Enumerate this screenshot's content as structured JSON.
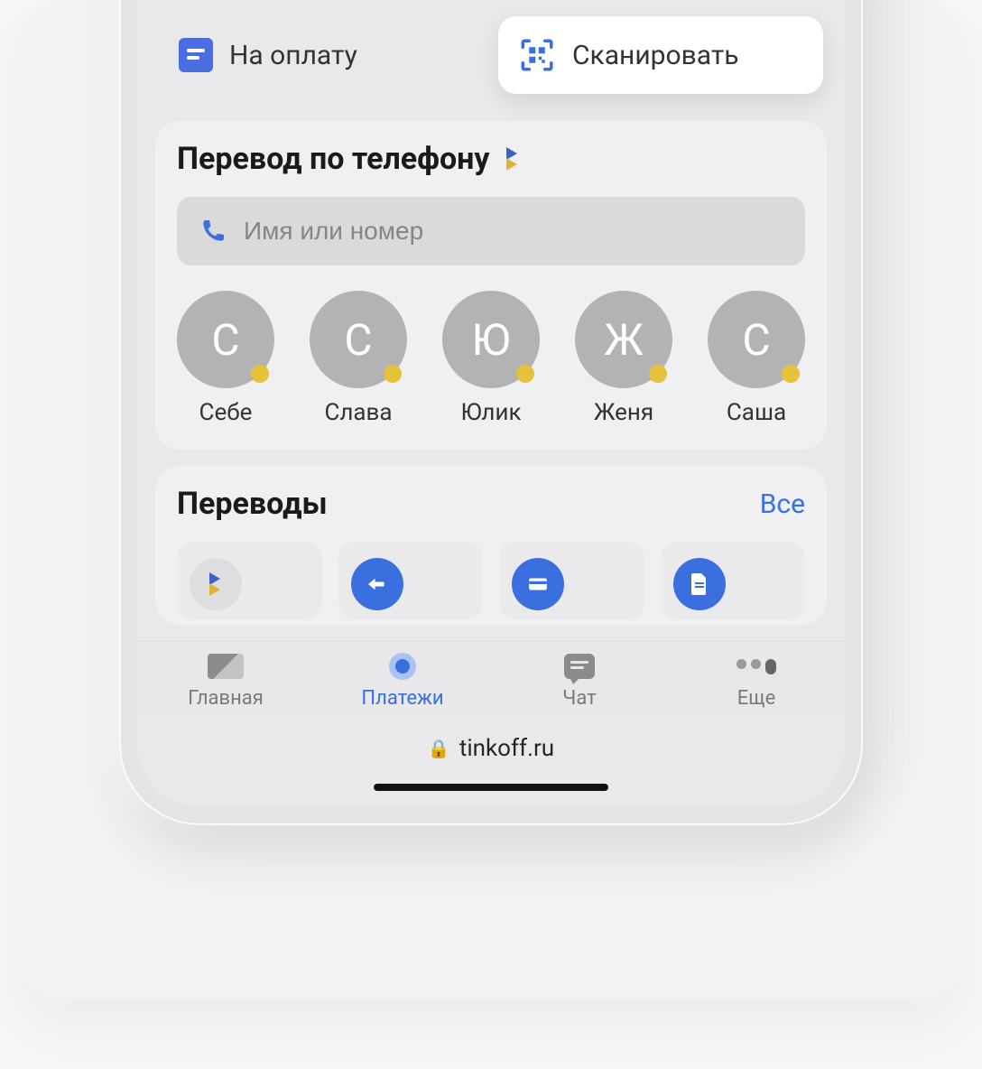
{
  "quick_actions": {
    "pay": "На оплату",
    "scan": "Сканировать"
  },
  "transfer_phone": {
    "title": "Перевод по телефону",
    "placeholder": "Имя или номер",
    "contacts": [
      {
        "initial": "С",
        "name": "Себе"
      },
      {
        "initial": "С",
        "name": "Слава"
      },
      {
        "initial": "Ю",
        "name": "Юлик"
      },
      {
        "initial": "Ж",
        "name": "Женя"
      },
      {
        "initial": "С",
        "name": "Саша"
      }
    ]
  },
  "transfers": {
    "title": "Переводы",
    "all_label": "Все"
  },
  "tabs": {
    "home": "Главная",
    "payments": "Платежи",
    "chat": "Чат",
    "more": "Еще"
  },
  "browser": {
    "url": "tinkoff.ru"
  }
}
